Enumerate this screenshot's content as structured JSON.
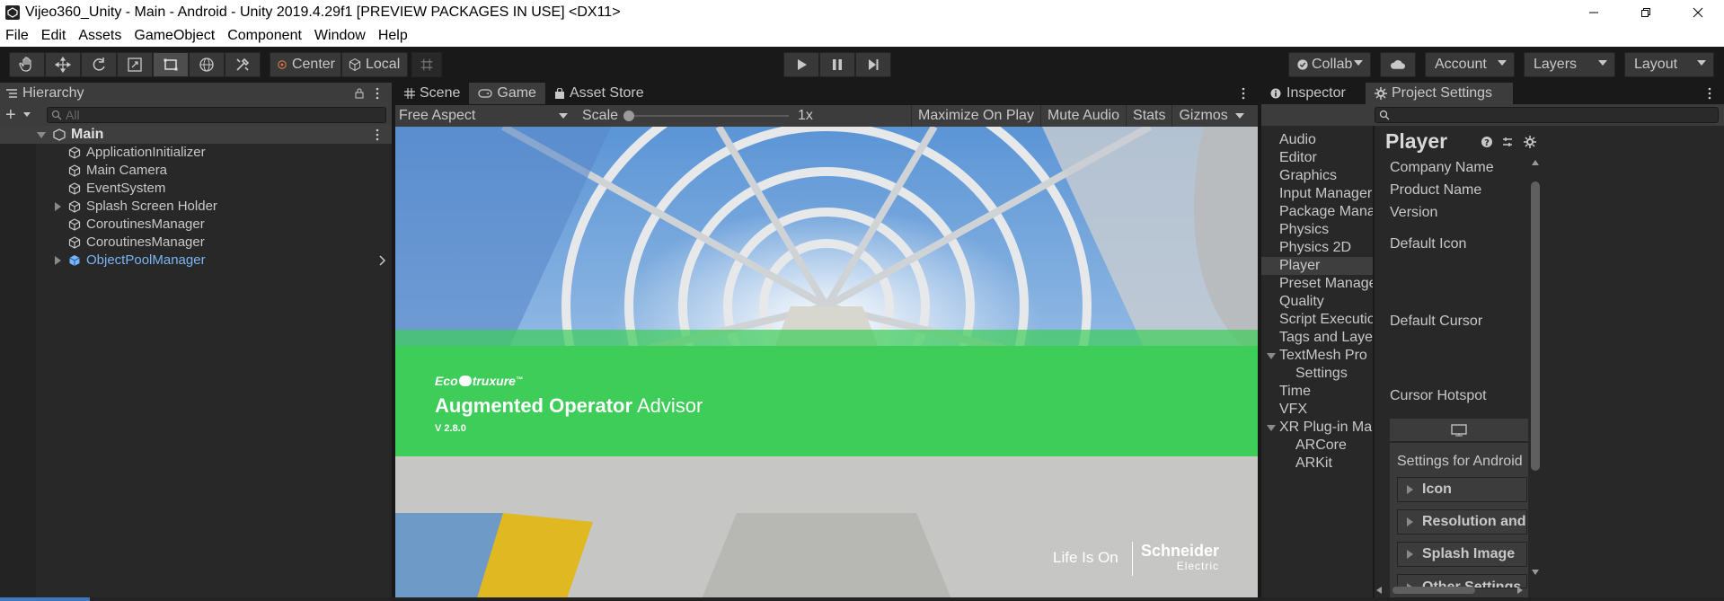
{
  "window": {
    "title": "Vijeo360_Unity - Main - Android - Unity 2019.4.29f1 [PREVIEW PACKAGES IN USE] <DX11>"
  },
  "menu": [
    "File",
    "Edit",
    "Assets",
    "GameObject",
    "Component",
    "Window",
    "Help"
  ],
  "toolbar": {
    "pivot_label": "Center",
    "space_label": "Local",
    "collab_label": "Collab",
    "account_label": "Account",
    "layers_label": "Layers",
    "layout_label": "Layout"
  },
  "hierarchy": {
    "tab_label": "Hierarchy",
    "search_placeholder": "All",
    "scene_name": "Main",
    "items": [
      {
        "label": "ApplicationInitializer",
        "has_children": false,
        "prefab": false
      },
      {
        "label": "Main Camera",
        "has_children": false,
        "prefab": false
      },
      {
        "label": "EventSystem",
        "has_children": false,
        "prefab": false
      },
      {
        "label": "Splash Screen Holder",
        "has_children": true,
        "prefab": false
      },
      {
        "label": "CoroutinesManager",
        "has_children": false,
        "prefab": false
      },
      {
        "label": "CoroutinesManager",
        "has_children": false,
        "prefab": false
      },
      {
        "label": "ObjectPoolManager",
        "has_children": true,
        "prefab": true
      }
    ]
  },
  "center_tabs": [
    "Scene",
    "Game",
    "Asset Store"
  ],
  "game_view": {
    "aspect_label": "Free Aspect",
    "scale_label": "Scale",
    "scale_value": "1x",
    "maximize_label": "Maximize On Play",
    "mute_label": "Mute Audio",
    "stats_label": "Stats",
    "gizmos_label": "Gizmos",
    "brand_eco": "Eco",
    "brand_struxure": "truxure",
    "tm": "™",
    "app_title_bold": "Augmented Operator",
    "app_title_light": "Advisor",
    "app_version": "V 2.8.0",
    "slogan_life": "Life Is On",
    "schneider_1": "Schneider",
    "schneider_2": "Electric"
  },
  "right_tabs": [
    "Inspector",
    "Project Settings"
  ],
  "project_settings": {
    "list": [
      "Audio",
      "Editor",
      "Graphics",
      "Input Manager",
      "Package Manager",
      "Physics",
      "Physics 2D",
      "Player",
      "Preset Manager",
      "Quality",
      "Script Execution Order",
      "Tags and Layers",
      "TextMesh Pro",
      "Settings",
      "Time",
      "VFX",
      "XR Plug-in Management",
      "ARCore",
      "ARKit"
    ],
    "selected": "Player",
    "heading": "Player",
    "fields": [
      "Company Name",
      "Product Name",
      "Version",
      "Default Icon",
      "Default Cursor",
      "Cursor Hotspot"
    ],
    "settings_for": "Settings for Android",
    "sections": [
      "Icon",
      "Resolution and Presentation",
      "Splash Image",
      "Other Settings"
    ]
  },
  "colors": {
    "accent_blue": "#7bb4f5",
    "selection": "#2c5d87",
    "banner_green": "#3dcd58",
    "progress": "#3a79bb"
  }
}
